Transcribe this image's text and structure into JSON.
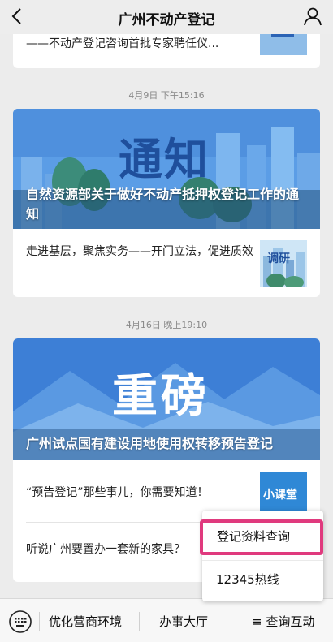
{
  "header": {
    "title": "广州不动产登记"
  },
  "top_item": {
    "text": "——不动产登记咨询首批专家聘任仪..."
  },
  "group1": {
    "timestamp": "4月9日 下午15:16",
    "banner_word": "通知",
    "banner_caption": "自然资源部关于做好不动产抵押权登记工作的通知",
    "item_text": "走进基层，聚焦实务——开门立法，促进质效",
    "item_thumb_word": "调研"
  },
  "group2": {
    "timestamp": "4月16日 晚上19:10",
    "banner_word": "重磅",
    "banner_caption": "广州试点国有建设用地使用权转移预告登记",
    "item1_text": "“预告登记”那些事儿，你需要知道！",
    "item1_thumb_word": "小课堂",
    "item2_text": "听说广州要置办一套新的家具？"
  },
  "bottom_menu": {
    "item1": "优化营商环境",
    "item2": "办事大厅",
    "item3": "≡ 查询互动"
  },
  "popup": {
    "item1": "登记资料查询",
    "item2": "12345热线"
  },
  "colors": {
    "highlight": "#e03a7e",
    "banner_blue": "#3d7fd6",
    "word_blue": "#1f4f9c"
  }
}
